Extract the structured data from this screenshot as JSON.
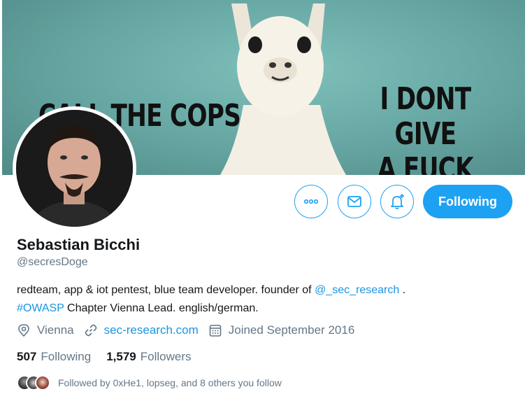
{
  "banner": {
    "caption_left": "CALL THE COPS",
    "caption_right_line1": "I DONT GIVE",
    "caption_right_line2": "A FUCK"
  },
  "profile": {
    "name": "Sebastian Bicchi",
    "handle": "@secresDoge",
    "bio": {
      "text1": "redteam, app & iot pentest, blue team developer. founder of ",
      "mention": "@_sec_research",
      "text2": " .",
      "hashtag": "#OWASP",
      "text3": " Chapter Vienna Lead. english/german."
    },
    "location": "Vienna",
    "website": "sec-research.com",
    "joined": "Joined September 2016",
    "following_count": "507",
    "following_label": "Following",
    "followers_count": "1,579",
    "followers_label": "Followers",
    "followed_by": "Followed by 0xHe1, lopseg, and 8 others you follow"
  },
  "actions": {
    "follow_label": "Following"
  },
  "icons": {
    "more": "more-icon",
    "message": "mail-icon",
    "notify": "bell-plus-icon",
    "location": "location-pin-icon",
    "link": "link-icon",
    "calendar": "calendar-icon"
  },
  "colors": {
    "accent": "#1da1f2",
    "link": "#1b95e0",
    "secondary_text": "#657786"
  }
}
